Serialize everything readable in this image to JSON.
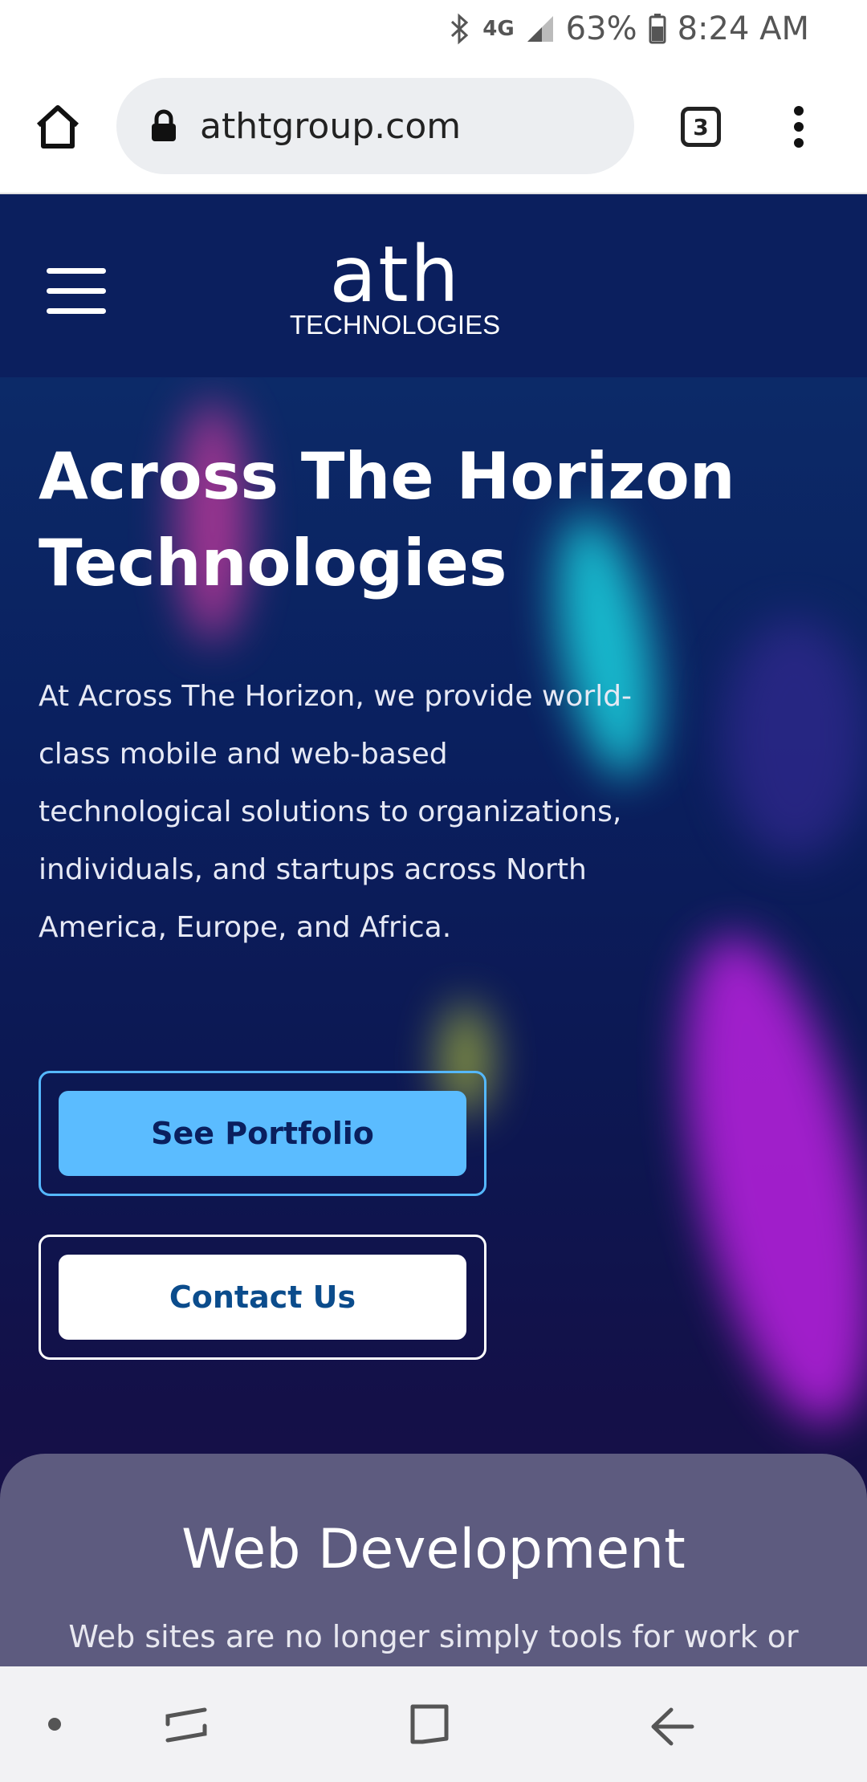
{
  "status_bar": {
    "battery": "63%",
    "time": "8:24 AM",
    "network": "4G",
    "icons": [
      "bluetooth-icon",
      "signal-icon",
      "battery-icon"
    ]
  },
  "browser": {
    "url": "athtgroup.com",
    "tab_count": "3",
    "icons": [
      "home-icon",
      "lock-icon",
      "overflow-menu-icon"
    ]
  },
  "site_header": {
    "logo_main": "ath",
    "logo_sub": "TECHNOLOGIES",
    "menu_icon": "hamburger-icon"
  },
  "hero": {
    "title": "Across The Horizon Technologies",
    "description": "At Across The Horizon, we provide world-class mobile and web-based technological solutions to organizations, individuals, and startups across North America, Europe, and Africa.",
    "primary_button": "See Portfolio",
    "secondary_button": "Contact Us"
  },
  "web_dev": {
    "title": "Web Development",
    "text": "Web sites are no longer simply tools for work or"
  },
  "nav_bar": {
    "icons": [
      "dot-icon",
      "recents-icon",
      "home-square-icon",
      "back-arrow-icon"
    ]
  },
  "colors": {
    "header_bg": "#0b1f5e",
    "primary_button": "#5bbcff",
    "contact_text": "#0b4c8c",
    "card_bg": "#5d5b7f"
  }
}
